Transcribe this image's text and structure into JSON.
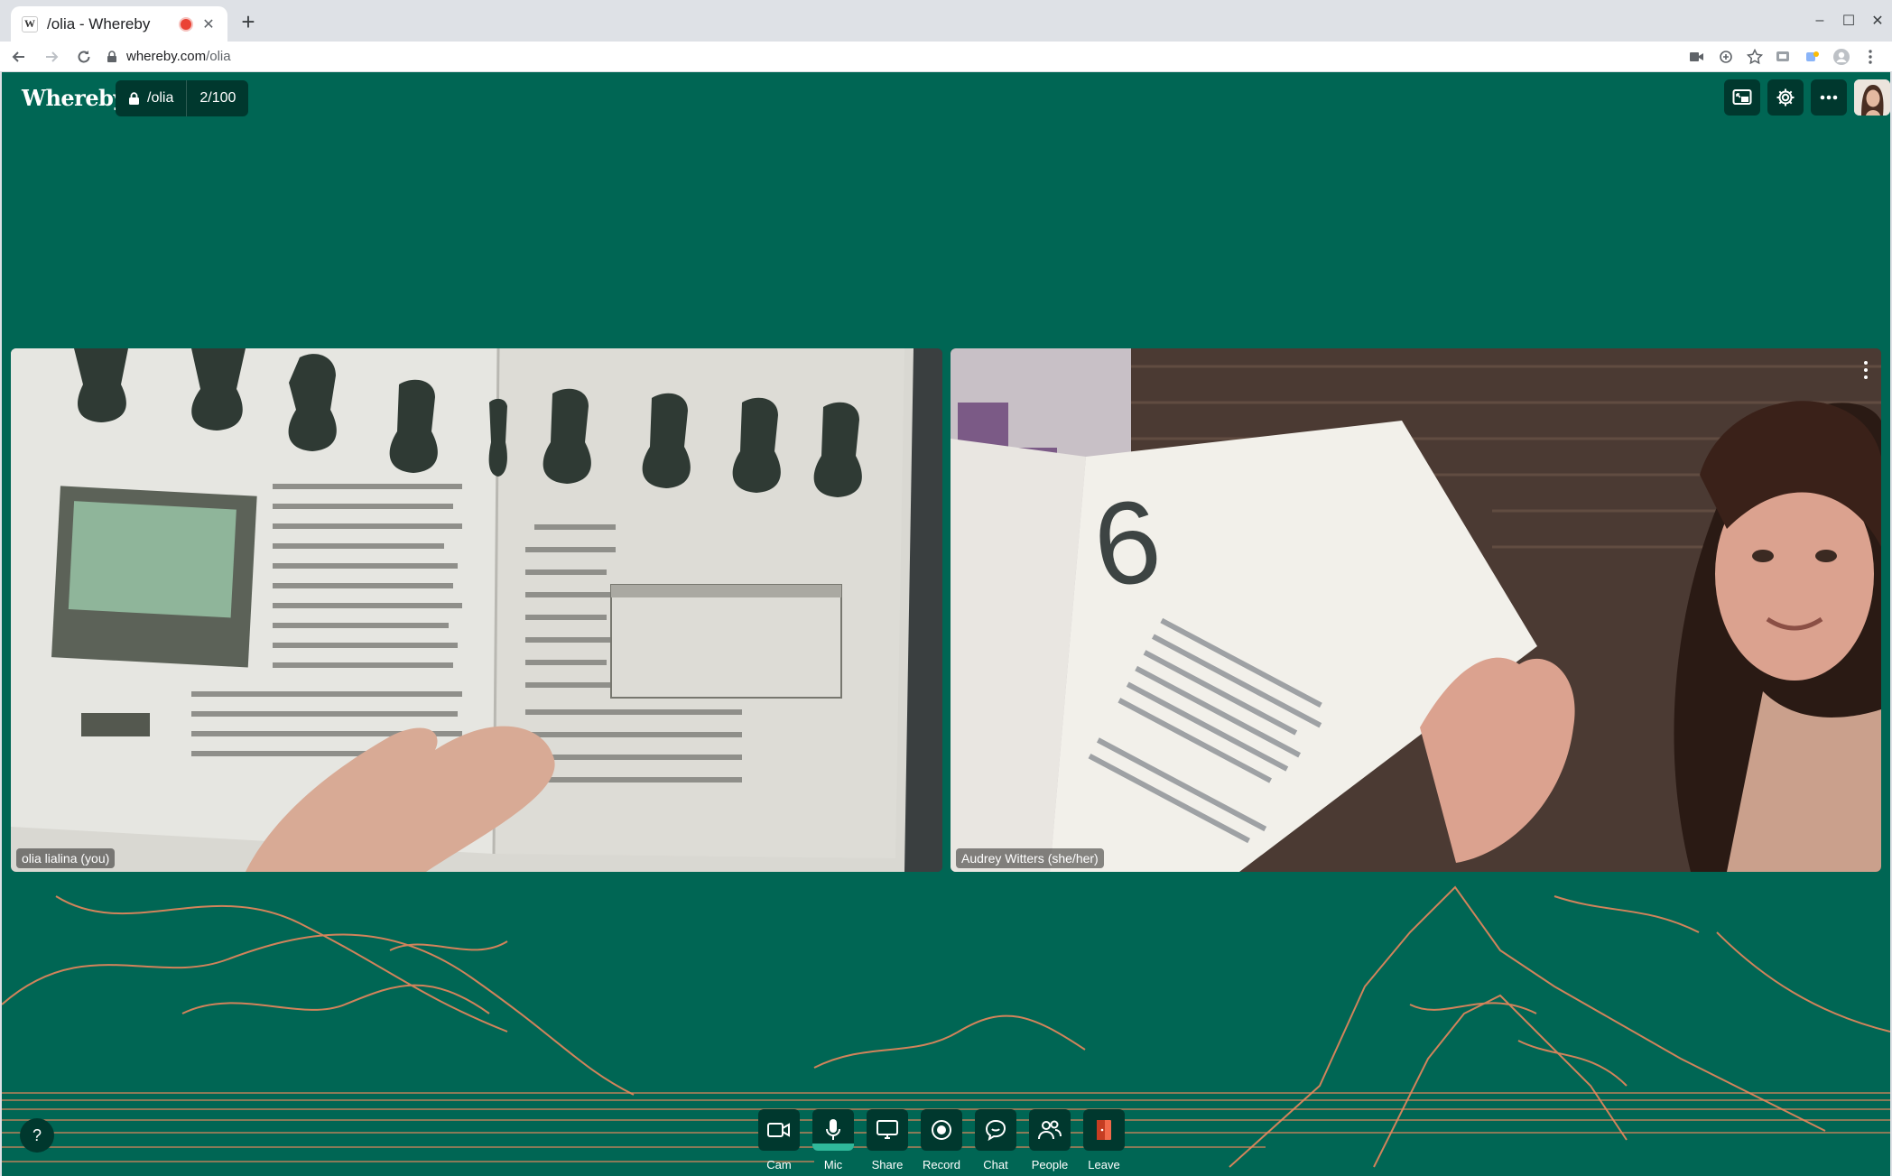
{
  "browser": {
    "tab_title": "/olia - Whereby",
    "favicon_letter": "W",
    "new_tab_symbol": "+",
    "close_symbol": "✕",
    "url_host": "whereby.com",
    "url_path": "/olia",
    "window_controls": [
      "–",
      "☐",
      "✕"
    ]
  },
  "room": {
    "logo": "Whereby",
    "room_name": "/olia",
    "participant_count": "2/100",
    "background_color": "#006654",
    "dark_color": "#00382e",
    "accent_color": "#f08a5d"
  },
  "participants": [
    {
      "name": "olia lialina (you)"
    },
    {
      "name": "Audrey Witters (she/her)"
    }
  ],
  "help": {
    "label": "?"
  },
  "controls": [
    {
      "label": "Cam",
      "icon": "camera-icon",
      "active": false
    },
    {
      "label": "Mic",
      "icon": "microphone-icon",
      "active": true
    },
    {
      "label": "Share",
      "icon": "screen-share-icon",
      "active": false
    },
    {
      "label": "Record",
      "icon": "record-icon",
      "active": false
    },
    {
      "label": "Chat",
      "icon": "chat-icon",
      "active": false
    },
    {
      "label": "People",
      "icon": "people-icon",
      "active": false
    },
    {
      "label": "Leave",
      "icon": "leave-icon",
      "active": false
    }
  ]
}
